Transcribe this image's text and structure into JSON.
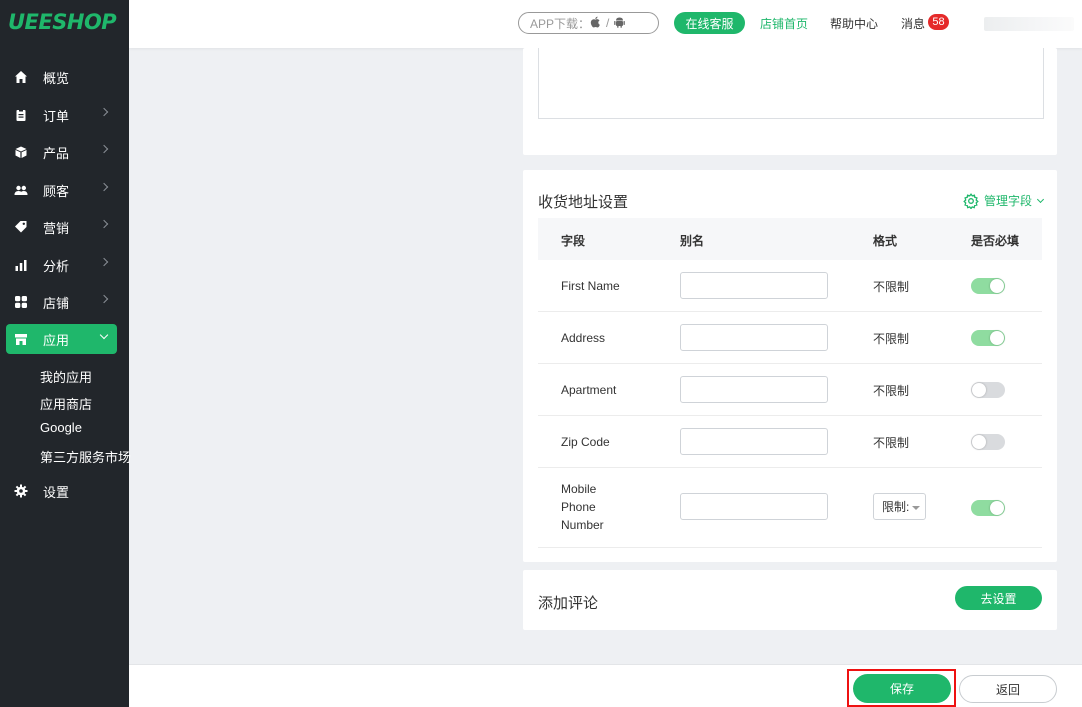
{
  "brand": {
    "logo": "UEESHOP"
  },
  "sidebar": {
    "items": [
      {
        "label": "概览",
        "icon": "home-icon"
      },
      {
        "label": "订单",
        "icon": "clipboard-icon"
      },
      {
        "label": "产品",
        "icon": "box-icon"
      },
      {
        "label": "顾客",
        "icon": "users-icon"
      },
      {
        "label": "营销",
        "icon": "tag-icon"
      },
      {
        "label": "分析",
        "icon": "bar-chart-icon"
      },
      {
        "label": "店铺",
        "icon": "grid-icon"
      },
      {
        "label": "应用",
        "icon": "store-icon"
      },
      {
        "label": "设置",
        "icon": "gear-icon"
      }
    ],
    "sub_items": [
      "我的应用",
      "应用商店",
      "Google",
      "第三方服务市场"
    ]
  },
  "topbar": {
    "app_download": "APP下载：",
    "separator": "/",
    "online_service": "在线客服",
    "store_home": "店铺首页",
    "help_center": "帮助中心",
    "messages": "消息",
    "message_count": "58"
  },
  "address_settings": {
    "title": "收货地址设置",
    "manage_fields": "管理字段",
    "columns": {
      "field": "字段",
      "alias": "别名",
      "format": "格式",
      "required": "是否必填"
    },
    "rows": [
      {
        "field": "First Name",
        "alias": "",
        "format": "不限制",
        "required": true
      },
      {
        "field": "Address",
        "alias": "",
        "format": "不限制",
        "required": true
      },
      {
        "field": "Apartment",
        "alias": "",
        "format": "不限制",
        "required": false
      },
      {
        "field": "Zip Code",
        "alias": "",
        "format": "不限制",
        "required": false
      },
      {
        "field": "Mobile Phone Number",
        "field_lines": [
          "Mobile",
          "Phone",
          "Number"
        ],
        "alias": "",
        "format": "限制:",
        "required": true
      }
    ]
  },
  "review": {
    "title": "添加评论",
    "button": "去设置"
  },
  "footer": {
    "save": "保存",
    "back": "返回"
  },
  "colors": {
    "accent": "#1fb76b",
    "sidebar_bg": "#22262b",
    "badge": "#e52a2a",
    "highlight": "#ee1111"
  }
}
